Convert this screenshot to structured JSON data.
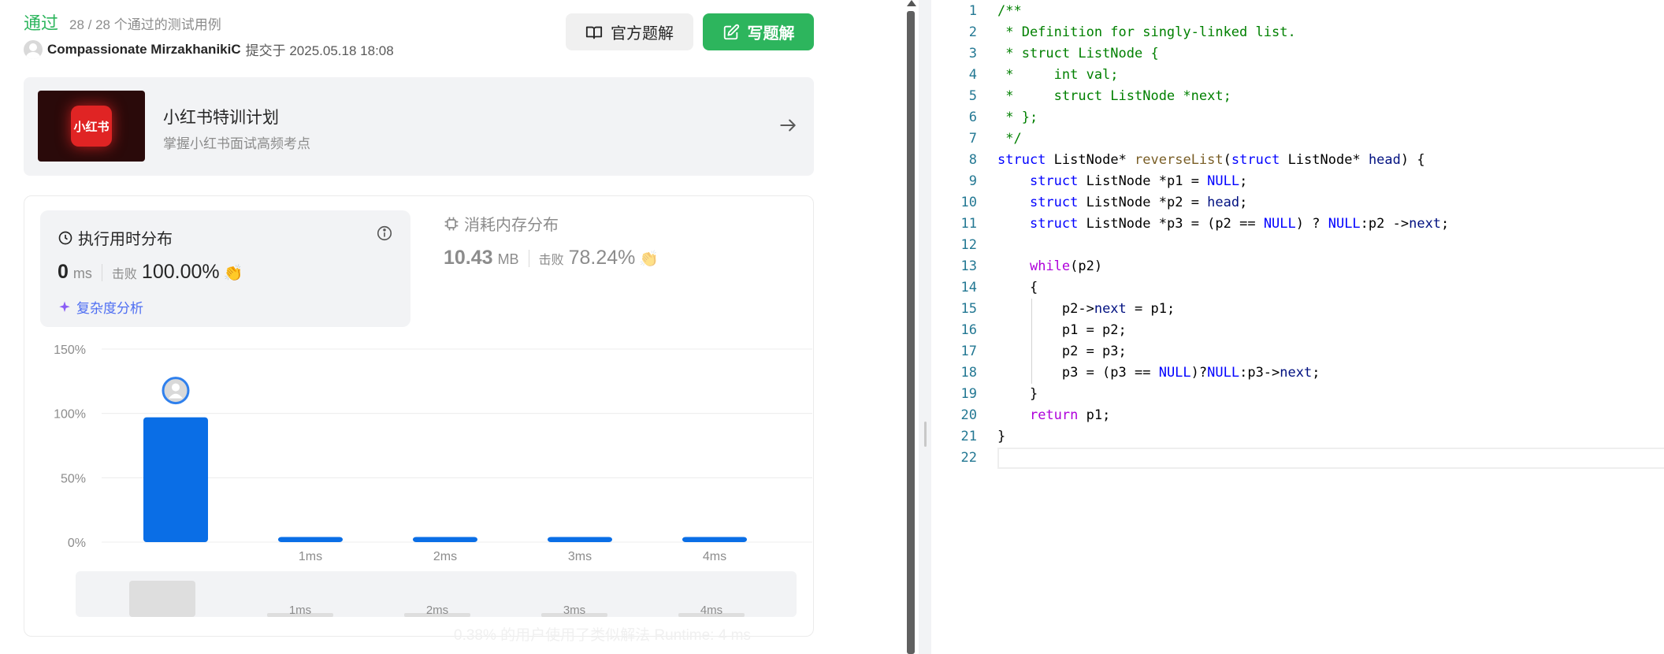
{
  "result": {
    "status": "通过",
    "summary": "28 / 28 个通过的测试用例",
    "submitter_name": "Compassionate MirzakhanikiC",
    "submitted_text": "提交于 2025.05.18 18:08"
  },
  "buttons": {
    "official_solution": "官方题解",
    "write_solution": "写题解"
  },
  "promo": {
    "logo_text": "小红书",
    "title": "小红书特训计划",
    "subtitle": "掌握小红书面试高频考点"
  },
  "runtime": {
    "title": "执行用时分布",
    "value": "0",
    "unit": "ms",
    "beat_label": "击败",
    "beat_pct": "100.00%",
    "complexity_link": "复杂度分析"
  },
  "memory": {
    "title": "消耗内存分布",
    "value": "10.43",
    "unit": "MB",
    "beat_label": "击败",
    "beat_pct": "78.24%"
  },
  "chart_tooltip": "0.38% 的用户使用了类似解法 Runtime: 4 ms",
  "chart_data": {
    "type": "bar",
    "categories": [
      "",
      "1ms",
      "2ms",
      "3ms",
      "4ms"
    ],
    "series": [
      {
        "values": [
          97,
          4,
          4,
          4,
          4
        ]
      }
    ],
    "ylim": [
      0,
      150
    ],
    "yticks": [
      "0%",
      "50%",
      "100%",
      "150%"
    ],
    "ytick_values": [
      0,
      50,
      100,
      150
    ],
    "grid": true,
    "highlight_index": 0,
    "navigator_labels": [
      "1ms",
      "2ms",
      "3ms",
      "4ms"
    ]
  },
  "colors": {
    "accent_green": "#2db55d",
    "bar_blue": "#0a6ee6",
    "link_blue": "#4e6ef2"
  },
  "editor": {
    "lines": [
      "/**",
      " * Definition for singly-linked list.",
      " * struct ListNode {",
      " *     int val;",
      " *     struct ListNode *next;",
      " * };",
      " */",
      "struct ListNode* reverseList(struct ListNode* head) {",
      "    struct ListNode *p1 = NULL;",
      "    struct ListNode *p2 = head;",
      "    struct ListNode *p3 = (p2 == NULL) ? NULL:p2 ->next;",
      "",
      "    while(p2)",
      "    {",
      "        p2->next = p1;",
      "        p1 = p2;",
      "        p2 = p3;",
      "        p3 = (p3 == NULL)?NULL:p3->next;",
      "    }",
      "    return p1;",
      "}",
      ""
    ]
  }
}
